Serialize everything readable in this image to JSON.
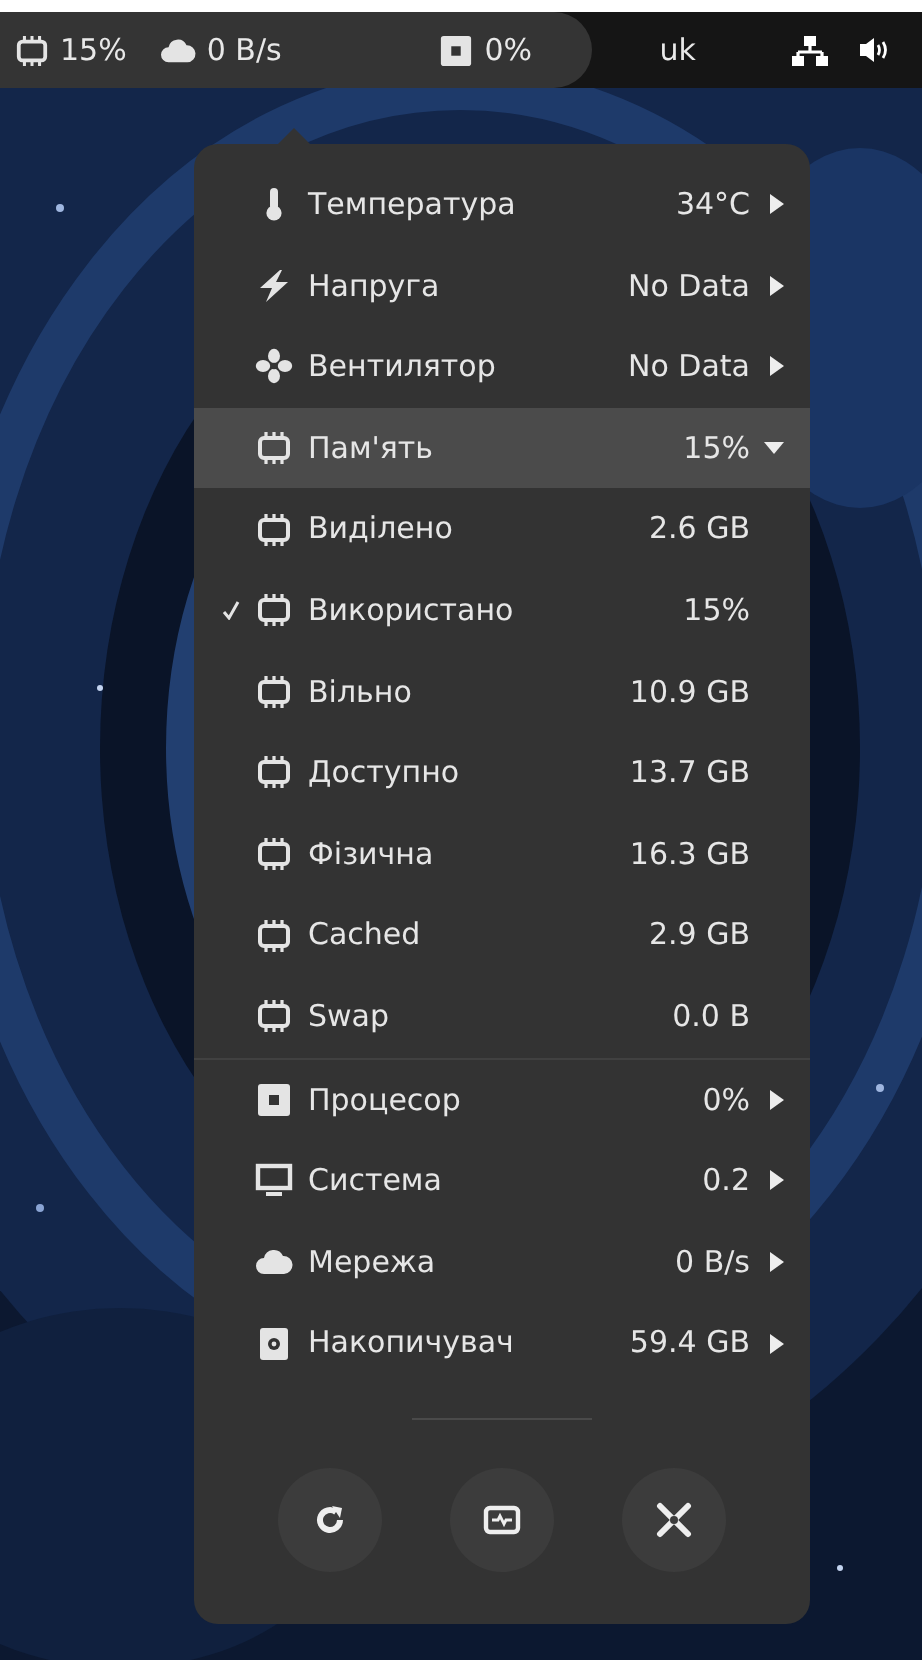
{
  "top_bar": {
    "indicators": [
      {
        "kind": "memory",
        "text": "15%"
      },
      {
        "kind": "network",
        "text": "0 B/s"
      },
      {
        "kind": "cpu",
        "text": "0%"
      }
    ],
    "language": "uk",
    "tray": [
      {
        "kind": "network"
      },
      {
        "kind": "volume"
      }
    ]
  },
  "menu": {
    "items": [
      {
        "kind": "temperature",
        "label": "Температура",
        "value": "34°C",
        "expanded": false
      },
      {
        "kind": "voltage",
        "label": "Напруга",
        "value": "No Data",
        "expanded": false
      },
      {
        "kind": "fan",
        "label": "Вентилятор",
        "value": "No Data",
        "expanded": false
      },
      {
        "kind": "memory",
        "label": "Пам'ять",
        "value": "15%",
        "expanded": true,
        "children": [
          {
            "label": "Виділено",
            "value": "2.6 GB",
            "selected": false
          },
          {
            "label": "Використано",
            "value": "15%",
            "selected": true
          },
          {
            "label": "Вільно",
            "value": "10.9 GB",
            "selected": false
          },
          {
            "label": "Доступно",
            "value": "13.7 GB",
            "selected": false
          },
          {
            "label": "Фізична",
            "value": "16.3 GB",
            "selected": false
          },
          {
            "label": "Cached",
            "value": "2.9 GB",
            "selected": false
          },
          {
            "label": "Swap",
            "value": "0.0 B",
            "selected": false
          }
        ]
      },
      {
        "kind": "cpu",
        "label": "Процесор",
        "value": "0%",
        "expanded": false
      },
      {
        "kind": "system",
        "label": "Система",
        "value": "0.2",
        "expanded": false
      },
      {
        "kind": "network",
        "label": "Мережа",
        "value": "0 B/s",
        "expanded": false
      },
      {
        "kind": "storage",
        "label": "Накопичувач",
        "value": "59.4 GB",
        "expanded": false
      }
    ],
    "buttons": [
      {
        "kind": "refresh"
      },
      {
        "kind": "monitor"
      },
      {
        "kind": "preferences"
      }
    ]
  }
}
